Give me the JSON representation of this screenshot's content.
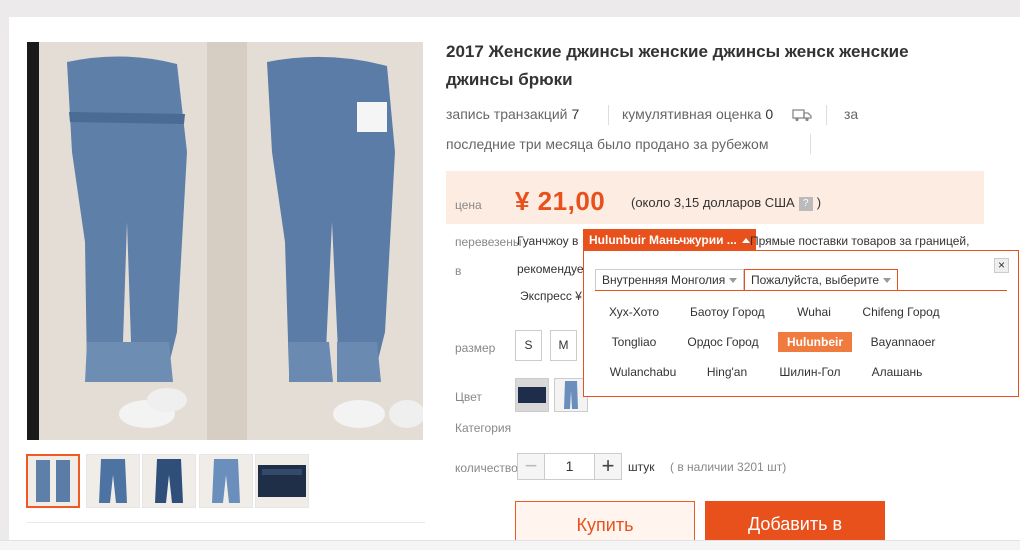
{
  "product": {
    "title": "2017 Женские джинсы женские джинсы женск женские джинсы брюки",
    "transactions_label": "запись транзакций",
    "transactions_count": "7",
    "rating_label": "кумулятивная оценка",
    "rating_count": "0",
    "sold_abroad_prefix": "за",
    "sold_abroad_text": "последние три месяца было продано за рубежом"
  },
  "price": {
    "label": "цена",
    "value": "¥ 21,00",
    "note_prefix": "(около 3,15 долларов США",
    "qmark": "?",
    "note_suffix": ")"
  },
  "shipping": {
    "label_line1": "перевезены",
    "label_line2": "в",
    "from_text": "Гуанчжоу в",
    "destination": "Hulunbuir Маньчжурии ...",
    "direct_text": "Прямые поставки товаров за границей,",
    "recommend_text": "рекомендуется",
    "express_text": "Экспресс ¥"
  },
  "options": {
    "size_label": "размер",
    "sizes": [
      "S",
      "M"
    ],
    "color_label": "Цвет",
    "category_label": "Категория",
    "quantity_label": "количество",
    "quantity_value": "1",
    "unit": "штук",
    "stock_text": "( в наличии 3201 шт)"
  },
  "actions": {
    "buy_label": "Купить",
    "add_to_cart_label": "Добавить в"
  },
  "region_popup": {
    "tab_province": "Внутренняя Монголия",
    "tab_city": "Пожалуйста, выберите",
    "close": "×",
    "selected_city": "Hulunbeir",
    "cities": [
      "Хух-Хото",
      "Баотоу Город",
      "Wuhai",
      "Chifeng Город",
      "Tongliao",
      "Ордос Город",
      "Hulunbeir",
      "Bayannaoer",
      "Wulanchabu",
      "Hing'an",
      "Шилин-Гол",
      "Алашань"
    ]
  },
  "colors": {
    "accent": "#e8501c",
    "price_band": "#fdece2",
    "selected_city": "#f07b3f"
  }
}
